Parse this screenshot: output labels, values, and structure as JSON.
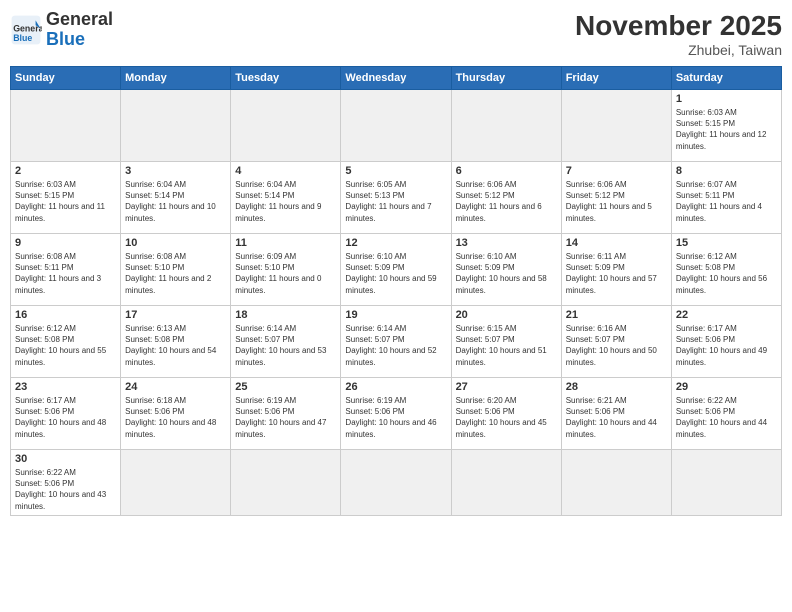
{
  "header": {
    "logo_general": "General",
    "logo_blue": "Blue",
    "month_title": "November 2025",
    "location": "Zhubei, Taiwan"
  },
  "weekdays": [
    "Sunday",
    "Monday",
    "Tuesday",
    "Wednesday",
    "Thursday",
    "Friday",
    "Saturday"
  ],
  "days": [
    {
      "num": "",
      "empty": true
    },
    {
      "num": "",
      "empty": true
    },
    {
      "num": "",
      "empty": true
    },
    {
      "num": "",
      "empty": true
    },
    {
      "num": "",
      "empty": true
    },
    {
      "num": "",
      "empty": true
    },
    {
      "num": "1",
      "sunrise": "6:03 AM",
      "sunset": "5:15 PM",
      "daylight": "11 hours and 12 minutes."
    },
    {
      "num": "2",
      "sunrise": "6:03 AM",
      "sunset": "5:15 PM",
      "daylight": "11 hours and 11 minutes."
    },
    {
      "num": "3",
      "sunrise": "6:04 AM",
      "sunset": "5:14 PM",
      "daylight": "11 hours and 10 minutes."
    },
    {
      "num": "4",
      "sunrise": "6:04 AM",
      "sunset": "5:14 PM",
      "daylight": "11 hours and 9 minutes."
    },
    {
      "num": "5",
      "sunrise": "6:05 AM",
      "sunset": "5:13 PM",
      "daylight": "11 hours and 7 minutes."
    },
    {
      "num": "6",
      "sunrise": "6:06 AM",
      "sunset": "5:12 PM",
      "daylight": "11 hours and 6 minutes."
    },
    {
      "num": "7",
      "sunrise": "6:06 AM",
      "sunset": "5:12 PM",
      "daylight": "11 hours and 5 minutes."
    },
    {
      "num": "8",
      "sunrise": "6:07 AM",
      "sunset": "5:11 PM",
      "daylight": "11 hours and 4 minutes."
    },
    {
      "num": "9",
      "sunrise": "6:08 AM",
      "sunset": "5:11 PM",
      "daylight": "11 hours and 3 minutes."
    },
    {
      "num": "10",
      "sunrise": "6:08 AM",
      "sunset": "5:10 PM",
      "daylight": "11 hours and 2 minutes."
    },
    {
      "num": "11",
      "sunrise": "6:09 AM",
      "sunset": "5:10 PM",
      "daylight": "11 hours and 0 minutes."
    },
    {
      "num": "12",
      "sunrise": "6:10 AM",
      "sunset": "5:09 PM",
      "daylight": "10 hours and 59 minutes."
    },
    {
      "num": "13",
      "sunrise": "6:10 AM",
      "sunset": "5:09 PM",
      "daylight": "10 hours and 58 minutes."
    },
    {
      "num": "14",
      "sunrise": "6:11 AM",
      "sunset": "5:09 PM",
      "daylight": "10 hours and 57 minutes."
    },
    {
      "num": "15",
      "sunrise": "6:12 AM",
      "sunset": "5:08 PM",
      "daylight": "10 hours and 56 minutes."
    },
    {
      "num": "16",
      "sunrise": "6:12 AM",
      "sunset": "5:08 PM",
      "daylight": "10 hours and 55 minutes."
    },
    {
      "num": "17",
      "sunrise": "6:13 AM",
      "sunset": "5:08 PM",
      "daylight": "10 hours and 54 minutes."
    },
    {
      "num": "18",
      "sunrise": "6:14 AM",
      "sunset": "5:07 PM",
      "daylight": "10 hours and 53 minutes."
    },
    {
      "num": "19",
      "sunrise": "6:14 AM",
      "sunset": "5:07 PM",
      "daylight": "10 hours and 52 minutes."
    },
    {
      "num": "20",
      "sunrise": "6:15 AM",
      "sunset": "5:07 PM",
      "daylight": "10 hours and 51 minutes."
    },
    {
      "num": "21",
      "sunrise": "6:16 AM",
      "sunset": "5:07 PM",
      "daylight": "10 hours and 50 minutes."
    },
    {
      "num": "22",
      "sunrise": "6:17 AM",
      "sunset": "5:06 PM",
      "daylight": "10 hours and 49 minutes."
    },
    {
      "num": "23",
      "sunrise": "6:17 AM",
      "sunset": "5:06 PM",
      "daylight": "10 hours and 48 minutes."
    },
    {
      "num": "24",
      "sunrise": "6:18 AM",
      "sunset": "5:06 PM",
      "daylight": "10 hours and 48 minutes."
    },
    {
      "num": "25",
      "sunrise": "6:19 AM",
      "sunset": "5:06 PM",
      "daylight": "10 hours and 47 minutes."
    },
    {
      "num": "26",
      "sunrise": "6:19 AM",
      "sunset": "5:06 PM",
      "daylight": "10 hours and 46 minutes."
    },
    {
      "num": "27",
      "sunrise": "6:20 AM",
      "sunset": "5:06 PM",
      "daylight": "10 hours and 45 minutes."
    },
    {
      "num": "28",
      "sunrise": "6:21 AM",
      "sunset": "5:06 PM",
      "daylight": "10 hours and 44 minutes."
    },
    {
      "num": "29",
      "sunrise": "6:22 AM",
      "sunset": "5:06 PM",
      "daylight": "10 hours and 44 minutes."
    },
    {
      "num": "30",
      "sunrise": "6:22 AM",
      "sunset": "5:06 PM",
      "daylight": "10 hours and 43 minutes."
    },
    {
      "num": "",
      "empty": true
    },
    {
      "num": "",
      "empty": true
    },
    {
      "num": "",
      "empty": true
    },
    {
      "num": "",
      "empty": true
    },
    {
      "num": "",
      "empty": true
    },
    {
      "num": "",
      "empty": true
    }
  ]
}
